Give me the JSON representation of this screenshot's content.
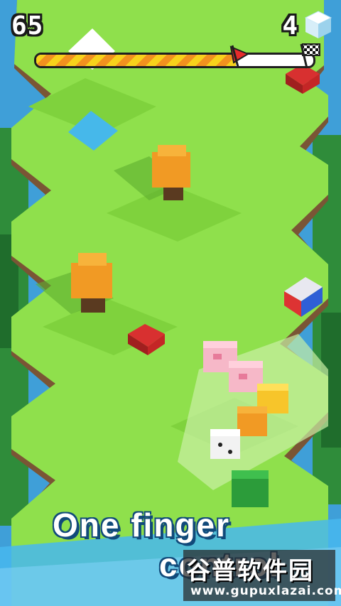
{
  "hud": {
    "score": "65",
    "cubes": "4",
    "progress_fraction": 0.72
  },
  "promo": {
    "line1": "One finger",
    "line2": "control"
  },
  "watermark": {
    "title": "谷普软件园",
    "url": "www.gupuxlazai.com"
  },
  "icons": [
    "white-cube-icon",
    "checkered-finish-flag-icon",
    "red-player-flag-icon"
  ],
  "colors": {
    "grass_light": "#8fe04c",
    "grass_dark": "#7fd23d",
    "dirt": "#7a5535",
    "sky": "#3f9fd8",
    "water": "#46b8ea",
    "progress_yellow": "#f7d21b",
    "progress_orange": "#f1911f"
  }
}
